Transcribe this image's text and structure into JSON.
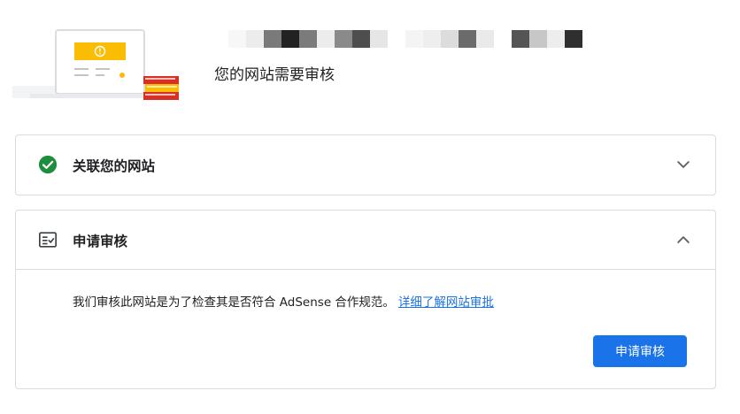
{
  "hero": {
    "title": "您的网站需要审核",
    "blurred_site_blocks": [
      "#ffffff",
      "#f7f7f7",
      "#ececec",
      "#7a7a7a",
      "#222222",
      "#7b7b7b",
      "#ececec",
      "#8a8a8a",
      "#4e4e4e",
      "#e6e6e6",
      "#ffffff",
      "#f4f4f4",
      "#eeeeee",
      "#dcdcdc",
      "#6b6b6b",
      "#eaeaea",
      "#ffffff",
      "#555555",
      "#c7c7c7",
      "#ededed",
      "#2f2f2f"
    ]
  },
  "sections": {
    "connect": {
      "title": "关联您的网站",
      "status_icon": "check-circle-icon",
      "expand_icon": "chevron-down-icon",
      "status_color": "#1e8e3e"
    },
    "review": {
      "title": "申请审核",
      "icon": "checklist-icon",
      "collapse_icon": "chevron-up-icon",
      "description": "我们审核此网站是为了检查其是否符合 AdSense 合作规范。",
      "learn_more_link": "详细了解网站审批",
      "button_label": "申请审核"
    }
  },
  "colors": {
    "accent": "#1a73e8",
    "success": "#1e8e3e",
    "warning": "#fbbc04",
    "border": "#dadce0"
  }
}
